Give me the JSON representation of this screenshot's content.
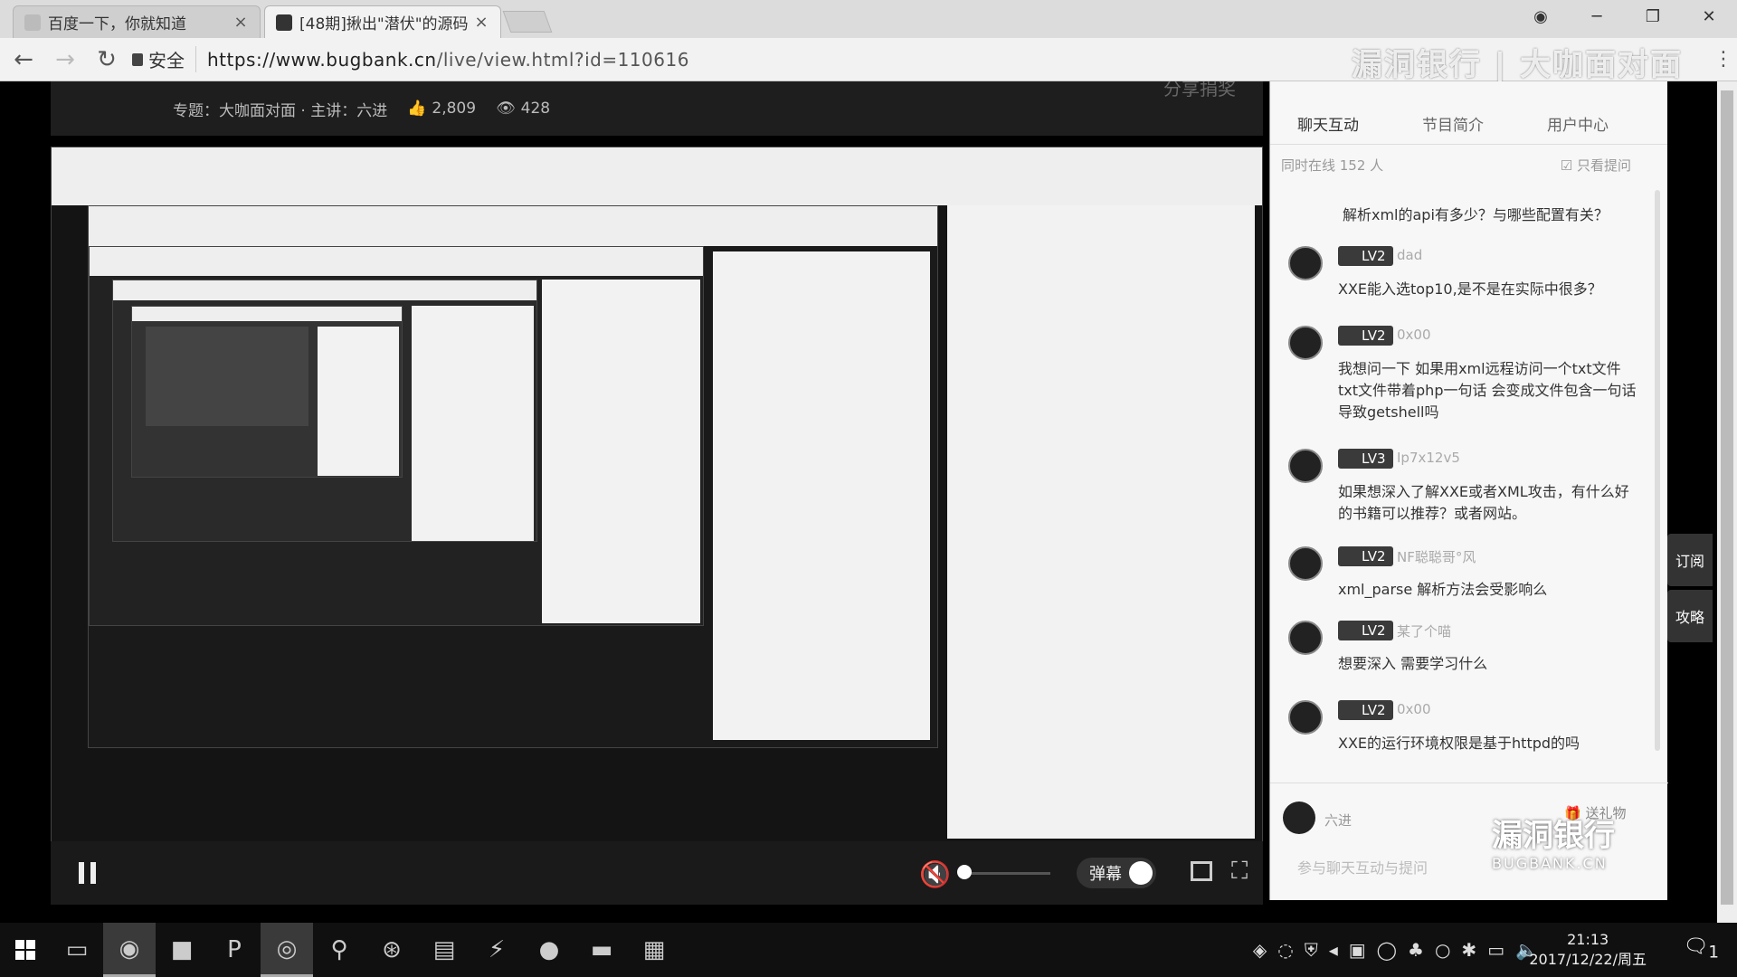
{
  "browser": {
    "tabs": [
      {
        "title": "百度一下，你就知道",
        "close": "×"
      },
      {
        "title": "[48期]揪出\"潜伏\"的源码",
        "close": "×"
      }
    ],
    "secure_label": "安全",
    "url_host": "https://www.bugbank.cn",
    "url_path": "/live/view.html?id=110616",
    "controls": {
      "account": "◉",
      "minimize": "─",
      "maximize": "❐",
      "close": "✕"
    }
  },
  "watermark_top": "漏洞银行 | 大咖面对面",
  "info_bar": {
    "topic": "专题：大咖面对面 · 主讲：六进",
    "likes": "2,809",
    "views": "428",
    "share": "分享捐奖"
  },
  "player": {
    "danmu_label": "弹幕"
  },
  "chat": {
    "tabs": [
      "聊天互动",
      "节目简介",
      "用户中心"
    ],
    "online": "同时在线  152  人",
    "only_questions": "只看提问",
    "question": "解析xml的api有多少？与哪些配置有关？",
    "messages": [
      {
        "level": "LV2",
        "user": "dad",
        "text": "XXE能入选top10,是不是在实际中很多？"
      },
      {
        "level": "LV2",
        "user": "0x00",
        "text": "我想问一下 如果用xml远程访问一个txt文件 txt文件带着php一句话 会变成文件包含一句话导致getshell吗"
      },
      {
        "level": "LV3",
        "user": "Ip7x12v5",
        "text": "如果想深入了解XXE或者XML攻击，有什么好的书籍可以推荐？或者网站。"
      },
      {
        "level": "LV2",
        "user": "NF聪聪哥°风",
        "text": "xml_parse 解析方法会受影响么"
      },
      {
        "level": "LV2",
        "user": "某了个喵",
        "text": "想要深入 需要学习什么"
      },
      {
        "level": "LV2",
        "user": "0x00",
        "text": "XXE的运行环境权限是基于httpd的吗"
      }
    ],
    "host_name": "六进",
    "gift": "送礼物",
    "input_placeholder": "参与聊天互动与提问"
  },
  "side_tabs": [
    "订阅",
    "攻略"
  ],
  "bugbank_logo": {
    "cn": "漏洞银行",
    "en": "BUGBANK.CN"
  },
  "taskbar": {
    "time": "21:13",
    "date": "2017/12/22/周五",
    "notifications": "1"
  }
}
